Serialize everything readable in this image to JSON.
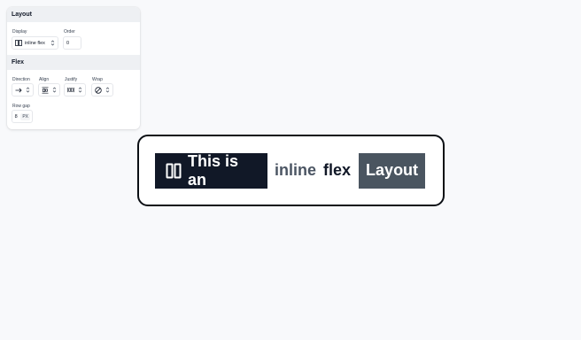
{
  "inspector": {
    "layout": {
      "title": "Layout",
      "display": {
        "label": "Display",
        "value": "inline flex",
        "icon": "columns-icon"
      },
      "order": {
        "label": "Order",
        "value": "0"
      }
    },
    "flex": {
      "title": "Flex",
      "direction": {
        "label": "Direction",
        "icon": "arrow-right-icon"
      },
      "align": {
        "label": "Align",
        "icon": "align-center-icon"
      },
      "justify": {
        "label": "Justify",
        "icon": "justify-icon"
      },
      "wrap": {
        "label": "Wrap",
        "icon": "no-wrap-icon"
      },
      "row_gap": {
        "label": "Row gap",
        "value": "8",
        "unit": "PX"
      }
    }
  },
  "canvas": {
    "chip_text": "This is an",
    "word_inline": "inline",
    "word_flex": "flex",
    "chip_layout": "Layout"
  },
  "colors": {
    "dark": "#111827",
    "slate": "#4a5560",
    "muted_text": "#4b5563",
    "panel_bg": "#ffffff",
    "section_bg": "#eef0f3"
  }
}
